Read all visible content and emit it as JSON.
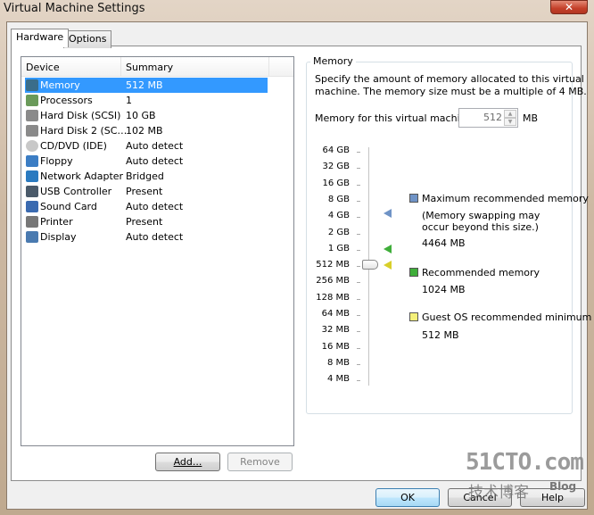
{
  "window": {
    "title": "Virtual Machine Settings",
    "close_icon": "close-icon"
  },
  "tabs": [
    {
      "label": "Hardware",
      "active": true
    },
    {
      "label": "Options",
      "active": false
    }
  ],
  "device_list": {
    "columns": [
      "Device",
      "Summary"
    ],
    "rows": [
      {
        "device": "Memory",
        "summary": "512 MB",
        "icon": "memory-icon",
        "selected": true
      },
      {
        "device": "Processors",
        "summary": "1",
        "icon": "processor-icon"
      },
      {
        "device": "Hard Disk (SCSI)",
        "summary": "10 GB",
        "icon": "hard-disk-icon"
      },
      {
        "device": "Hard Disk 2 (SC…",
        "summary": "102 MB",
        "icon": "hard-disk-icon"
      },
      {
        "device": "CD/DVD (IDE)",
        "summary": "Auto detect",
        "icon": "cd-dvd-icon"
      },
      {
        "device": "Floppy",
        "summary": "Auto detect",
        "icon": "floppy-icon"
      },
      {
        "device": "Network Adapter",
        "summary": "Bridged",
        "icon": "network-adapter-icon"
      },
      {
        "device": "USB Controller",
        "summary": "Present",
        "icon": "usb-icon"
      },
      {
        "device": "Sound Card",
        "summary": "Auto detect",
        "icon": "speaker-icon"
      },
      {
        "device": "Printer",
        "summary": "Present",
        "icon": "printer-icon"
      },
      {
        "device": "Display",
        "summary": "Auto detect",
        "icon": "monitor-icon"
      }
    ],
    "add_label": "Add...",
    "remove_label": "Remove"
  },
  "memory": {
    "group_label": "Memory",
    "description_line1": "Specify the amount of memory allocated to this virtual",
    "description_line2": "machine. The memory size must be a multiple of 4 MB.",
    "field_label": "Memory for this virtual machine:",
    "field_value": "512",
    "unit": "MB",
    "scale_labels": [
      "64 GB",
      "32 GB",
      "16 GB",
      "8 GB",
      "4 GB",
      "2 GB",
      "1 GB",
      "512 MB",
      "256 MB",
      "128 MB",
      "64 MB",
      "32 MB",
      "16 MB",
      "8 MB",
      "4 MB"
    ],
    "slider_value": "512 MB",
    "legend": {
      "max_label": "Maximum recommended memory",
      "max_note1": "(Memory swapping may",
      "max_note2": "occur beyond this size.)",
      "max_value": "4464 MB",
      "max_color": "#6f93c6",
      "rec_label": "Recommended memory",
      "rec_value": "1024 MB",
      "rec_color": "#3fae3a",
      "min_label": "Guest OS recommended minimum",
      "min_value": "512 MB",
      "min_color": "#f4f07a"
    }
  },
  "footer": {
    "ok": "OK",
    "cancel": "Cancel",
    "help": "Help"
  },
  "watermark": {
    "line1": "51CTO.com",
    "line2": "技术博客",
    "line3": "Blog"
  }
}
